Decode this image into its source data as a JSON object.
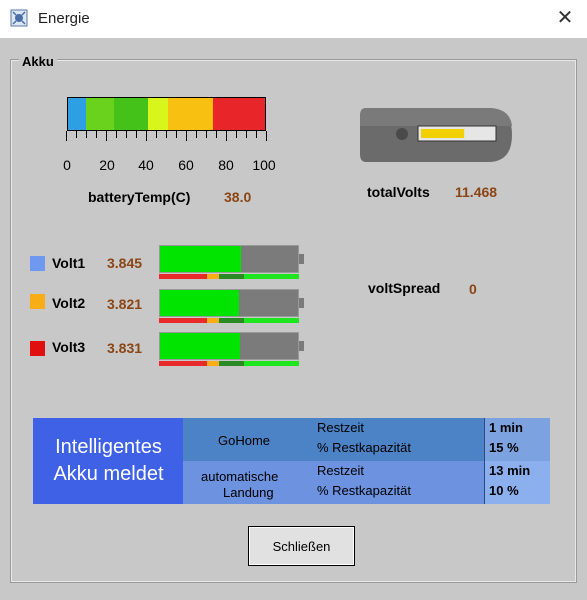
{
  "window": {
    "title": "Energie",
    "close_symbol": "✕"
  },
  "group": {
    "label": "Akku"
  },
  "temp": {
    "scale_labels": [
      "0",
      "20",
      "40",
      "60",
      "80",
      "100"
    ],
    "label": "batteryTemp(C)",
    "value": "38.0",
    "colors": [
      "#2f9fe3",
      "#6ad21c",
      "#45c21a",
      "#d8f51c",
      "#f8c010",
      "#e8262a"
    ]
  },
  "total": {
    "label": "totalVolts",
    "value": "11.468",
    "level": 0.6
  },
  "cells": [
    {
      "label": "Volt1",
      "value": "3.845",
      "color": "#6f98f0",
      "fill": 0.59
    },
    {
      "label": "Volt2",
      "value": "3.821",
      "color": "#f8ac16",
      "fill": 0.57
    },
    {
      "label": "Volt3",
      "value": "3.831",
      "color": "#e01010",
      "fill": 0.58
    }
  ],
  "spread": {
    "label": "voltSpread",
    "value": "0"
  },
  "report": {
    "title_line1": "Intelligentes",
    "title_line2": "Akku meldet",
    "gohome": {
      "label": "GoHome",
      "restzeit_label": "Restzeit",
      "restzeit_value": "1 min",
      "kap_label": "% Restkapazität",
      "kap_value": "15 %"
    },
    "landing": {
      "label_line1": "automatische",
      "label_line2": "Landung",
      "restzeit_label": "Restzeit",
      "restzeit_value": "13 min",
      "kap_label": "% Restkapazität",
      "kap_value": "10 %"
    }
  },
  "close_button": {
    "label": "Schließen"
  }
}
